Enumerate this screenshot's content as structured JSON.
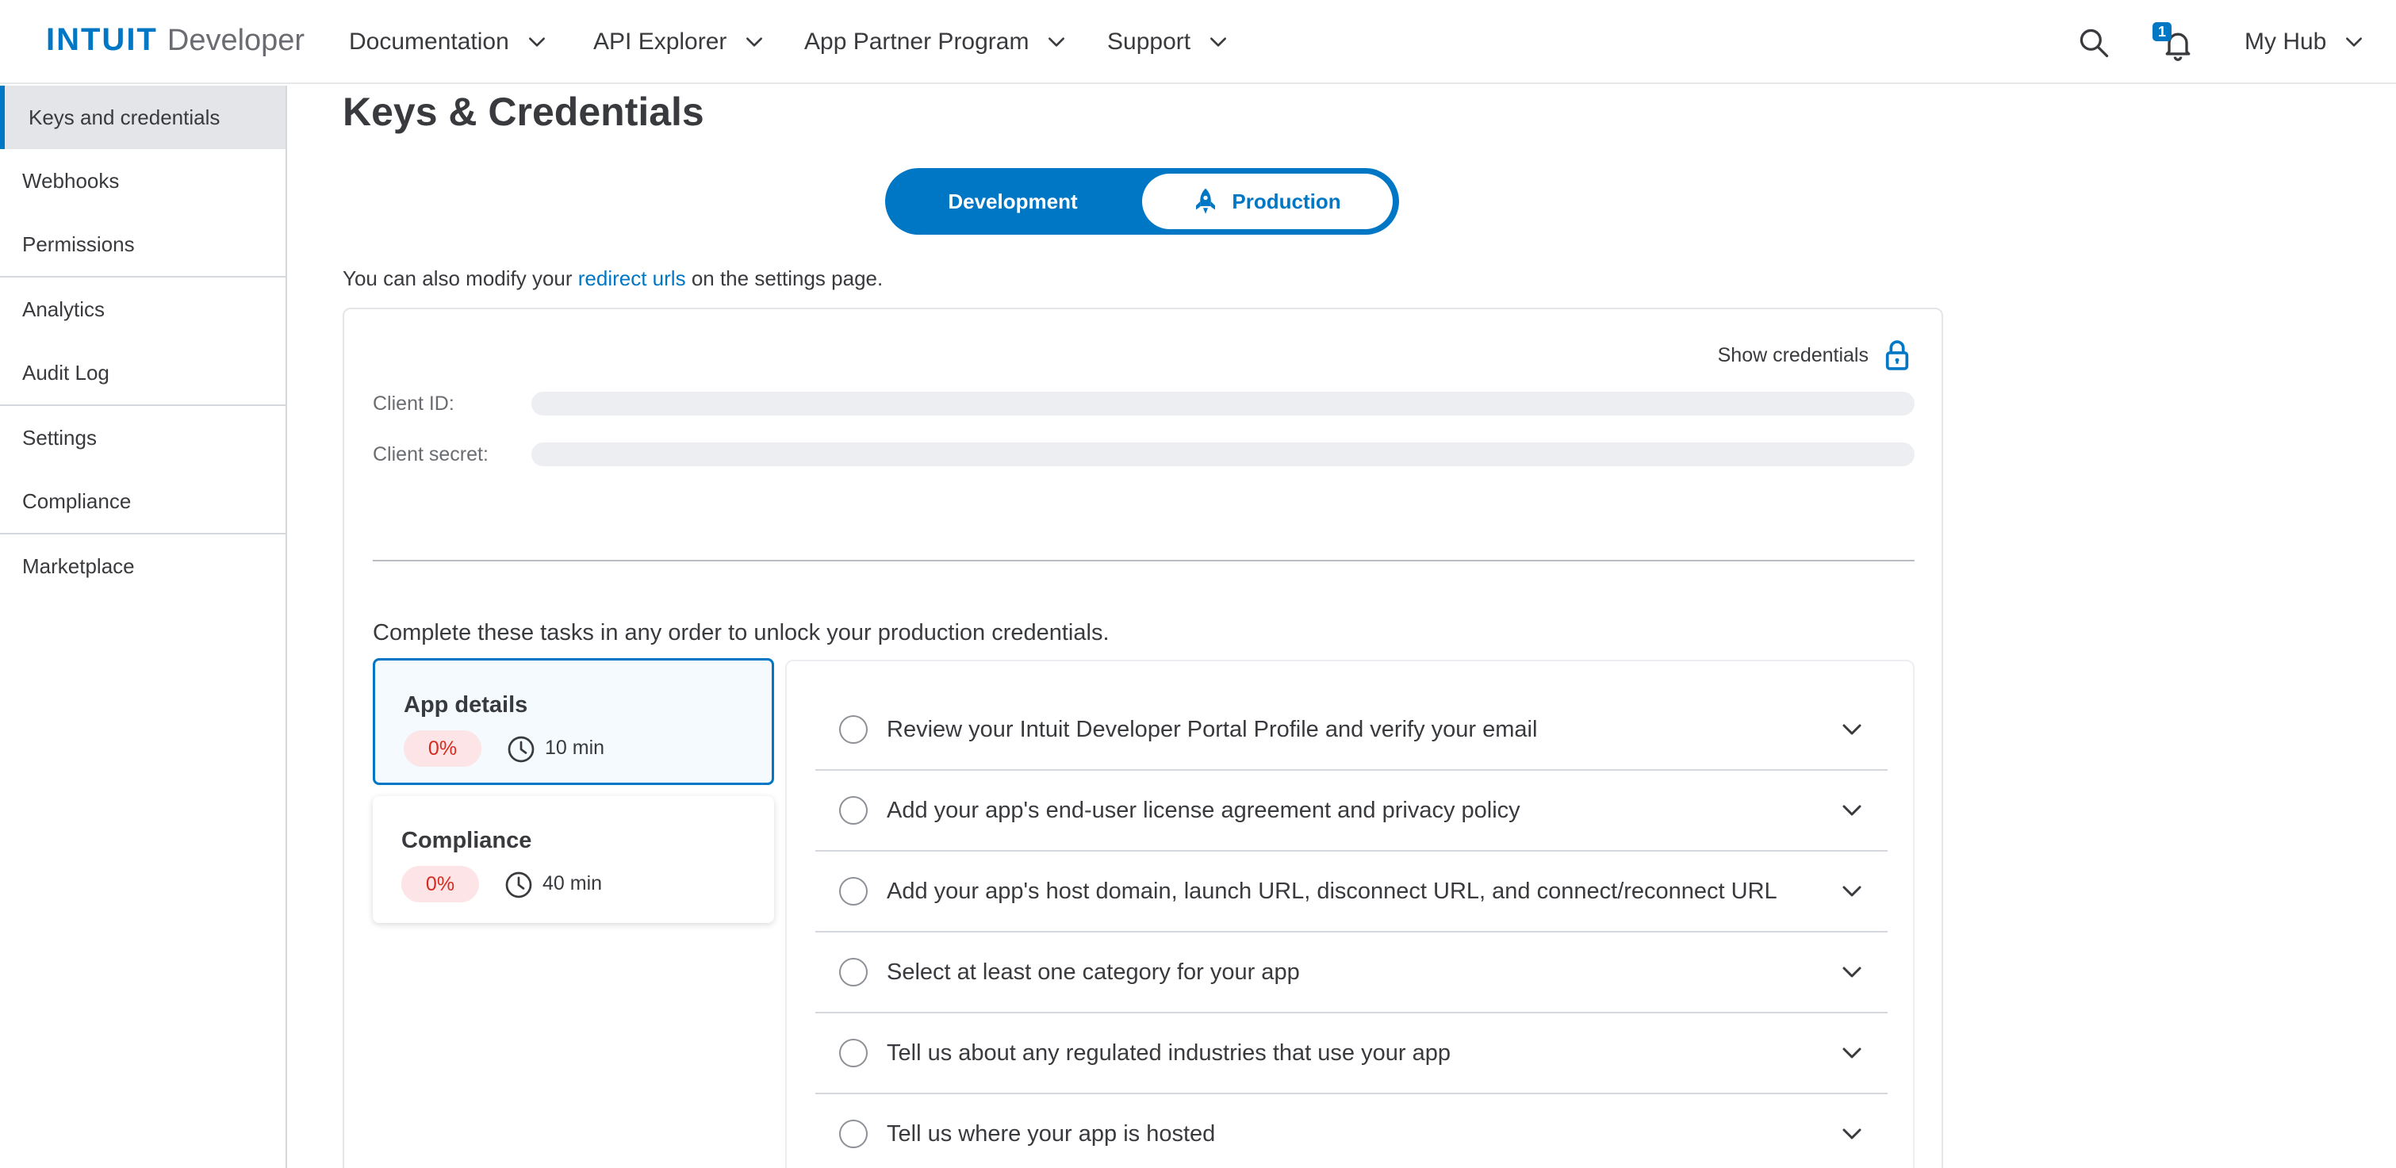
{
  "header": {
    "logo_brand": "INTUIT",
    "logo_sub": "Developer",
    "nav": [
      {
        "label": "Documentation"
      },
      {
        "label": "API Explorer"
      },
      {
        "label": "App Partner Program"
      },
      {
        "label": "Support"
      }
    ],
    "notification_count": "1",
    "myhub_label": "My Hub"
  },
  "sidebar": {
    "items": [
      {
        "label": "Keys and credentials",
        "active": true
      },
      {
        "label": "Webhooks"
      },
      {
        "label": "Permissions"
      },
      {
        "label": "Analytics"
      },
      {
        "label": "Audit Log"
      },
      {
        "label": "Settings"
      },
      {
        "label": "Compliance"
      },
      {
        "label": "Marketplace"
      }
    ]
  },
  "main": {
    "title": "Keys & Credentials",
    "toggle": {
      "development": "Development",
      "production": "Production",
      "selected": "Production"
    },
    "info": {
      "before": "You can also modify your ",
      "link": "redirect urls",
      "after": " on the settings page."
    },
    "credentials": {
      "show_label": "Show credentials",
      "client_id_label": "Client ID:",
      "client_secret_label": "Client secret:"
    },
    "tasks_intro": "Complete these tasks in any order to unlock your production credentials.",
    "task_cards": [
      {
        "title": "App details",
        "progress": "0%",
        "duration": "10 min",
        "active": true
      },
      {
        "title": "Compliance",
        "progress": "0%",
        "duration": "40 min"
      }
    ],
    "checklist": [
      "Review your Intuit Developer Portal Profile and verify your email",
      "Add your app's end-user license agreement and privacy policy",
      "Add your app's host domain, launch URL, disconnect URL, and connect/reconnect URL",
      "Select at least one category for your app",
      "Tell us about any regulated industries that use your app",
      "Tell us where your app is hosted"
    ]
  },
  "colors": {
    "accent": "#0077c5",
    "danger": "#d52b1e",
    "danger_bg": "#fde4e6"
  }
}
